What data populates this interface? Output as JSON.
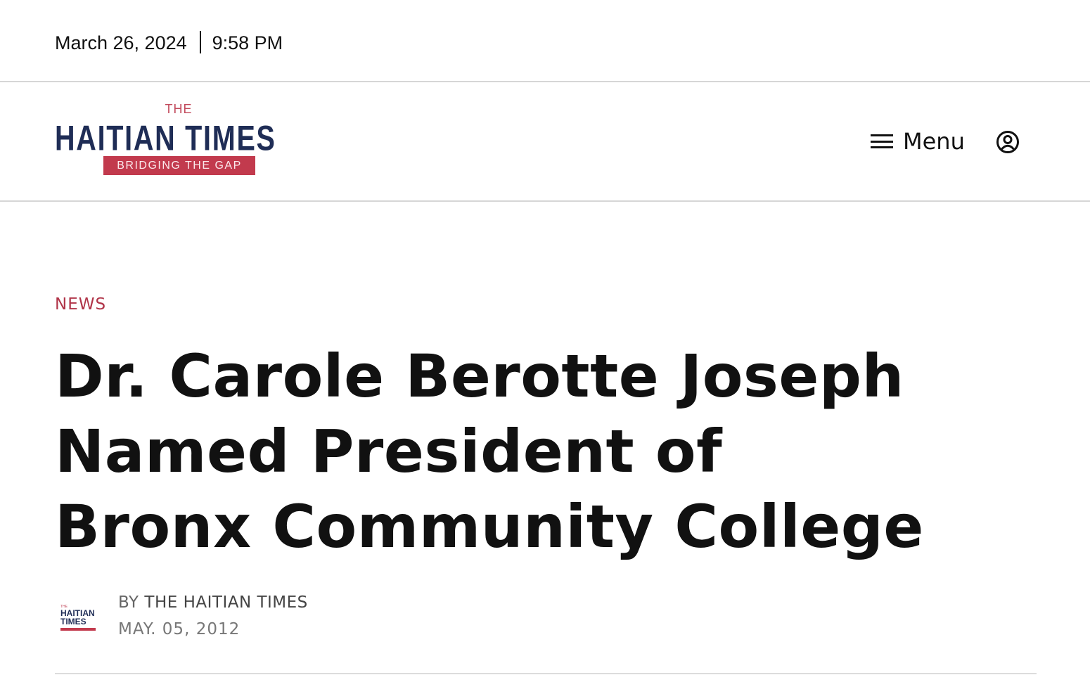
{
  "topbar": {
    "date": "March 26, 2024",
    "time": "9:58 PM"
  },
  "header": {
    "logo": {
      "the": "THE",
      "name": "HAITIAN TIMES",
      "tagline": "BRIDGING THE GAP"
    },
    "menu_label": "Menu",
    "icons": {
      "menu": "hamburger-menu-icon",
      "account": "user-circle-icon"
    }
  },
  "article": {
    "category": "NEWS",
    "headline": "Dr. Carole Berotte Joseph Named President of Bronx Community College",
    "byline_prefix": "BY",
    "author": "THE HAITIAN TIMES",
    "date": "MAY. 05, 2012"
  },
  "colors": {
    "brand_navy": "#1f2d56",
    "brand_red": "#c23a4d",
    "category_red": "#b03448"
  }
}
